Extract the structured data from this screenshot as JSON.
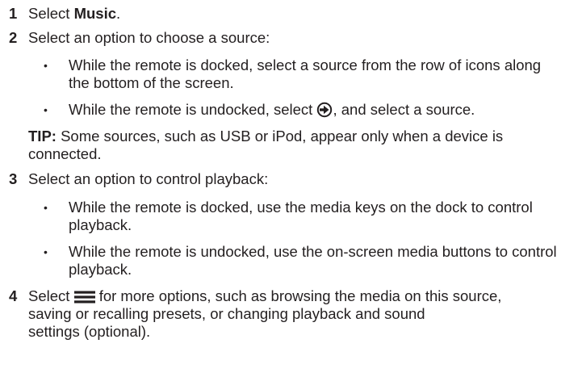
{
  "steps": [
    {
      "number": "1",
      "prefix": "Select ",
      "bold": "Music",
      "suffix": "."
    },
    {
      "number": "2",
      "text": "Select an option to choose a source:",
      "bullets": [
        {
          "line1": "While the remote is docked, select a source from the row of icons along",
          "line2": "the bottom of the screen."
        },
        {
          "prefix": "While the remote is undocked, select ",
          "icon": "source-arrow-icon",
          "suffix": ", and select a source."
        }
      ],
      "tip": {
        "label": "TIP:",
        "line1": " Some sources, such as USB or iPod, appear only when a device is",
        "line2": "connected."
      }
    },
    {
      "number": "3",
      "text": "Select an option to control playback:",
      "bullets": [
        {
          "line1": "While the remote is docked, use the media keys on the dock to control",
          "line2": "playback."
        },
        {
          "line1": "While the remote is undocked, use the on-screen media buttons to control",
          "line2": "playback."
        }
      ]
    },
    {
      "number": "4",
      "prefix": "Select ",
      "icon": "menu-icon",
      "line1_suffix": " for more options, such as browsing the media on this source,",
      "line2": "saving or recalling presets, or changing playback and sound",
      "line3": "settings (optional)."
    }
  ],
  "bullet_char": "•"
}
